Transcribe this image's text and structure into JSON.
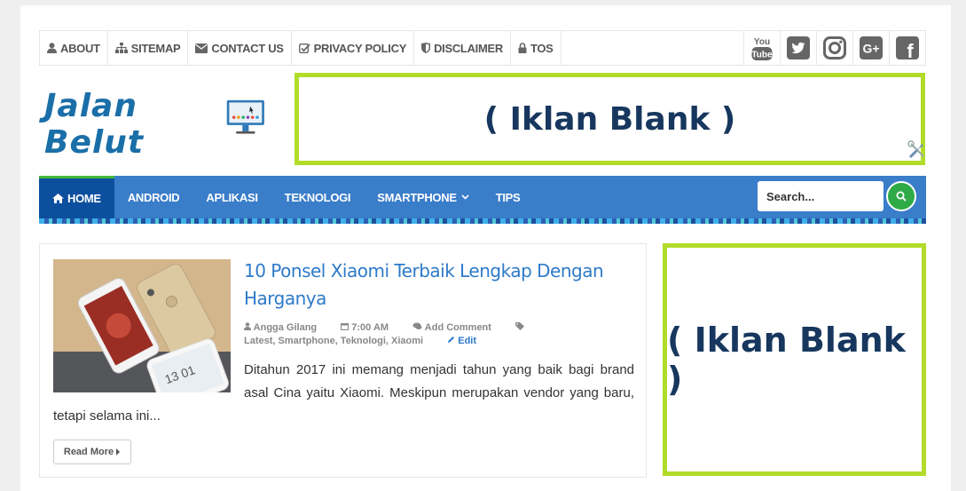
{
  "topnav": {
    "items": [
      {
        "label": "ABOUT",
        "icon": "user-icon"
      },
      {
        "label": "SITEMAP",
        "icon": "sitemap-icon"
      },
      {
        "label": "CONTACT US",
        "icon": "envelope-icon"
      },
      {
        "label": "PRIVACY POLICY",
        "icon": "check-square-icon"
      },
      {
        "label": "DISCLAIMER",
        "icon": "shield-icon"
      },
      {
        "label": "TOS",
        "icon": "lock-icon"
      }
    ],
    "social": [
      {
        "icon": "youtube-icon",
        "top": "You",
        "bottom": "Tube"
      },
      {
        "icon": "twitter-icon"
      },
      {
        "icon": "instagram-icon"
      },
      {
        "icon": "google-plus-icon",
        "label": "G+"
      },
      {
        "icon": "facebook-icon",
        "label": "f"
      }
    ]
  },
  "header": {
    "logo_text": "Jalan Belut",
    "ad_top": "( Iklan Blank )"
  },
  "mainnav": {
    "items": [
      {
        "label": "HOME",
        "active": true
      },
      {
        "label": "ANDROID"
      },
      {
        "label": "APLIKASI"
      },
      {
        "label": "TEKNOLOGI"
      },
      {
        "label": "SMARTPHONE",
        "dropdown": true
      },
      {
        "label": "TIPS"
      }
    ],
    "search_placeholder": "Search..."
  },
  "post": {
    "title": "10 Ponsel Xiaomi Terbaik Lengkap Dengan Harganya",
    "author": "Angga Gilang",
    "time": "7:00 AM",
    "comment": "Add Comment",
    "tags": "Latest, Smartphone, Teknologi, Xiaomi",
    "edit": "Edit",
    "excerpt": "Ditahun 2017 ini memang menjadi tahun yang baik bagi brand asal Cina yaitu Xiaomi. Meskipun merupakan vendor yang baru, tetapi selama ini...",
    "read_more": "Read More",
    "thumb_text": "13 01"
  },
  "sidebar": {
    "ad_side": "( Iklan Blank )"
  },
  "colors": {
    "nav_blue": "#3a7dc9",
    "nav_active": "#0c4f9e",
    "ad_border": "#b2dc2a",
    "ad_text": "#17375e",
    "link": "#2d7ac9"
  }
}
